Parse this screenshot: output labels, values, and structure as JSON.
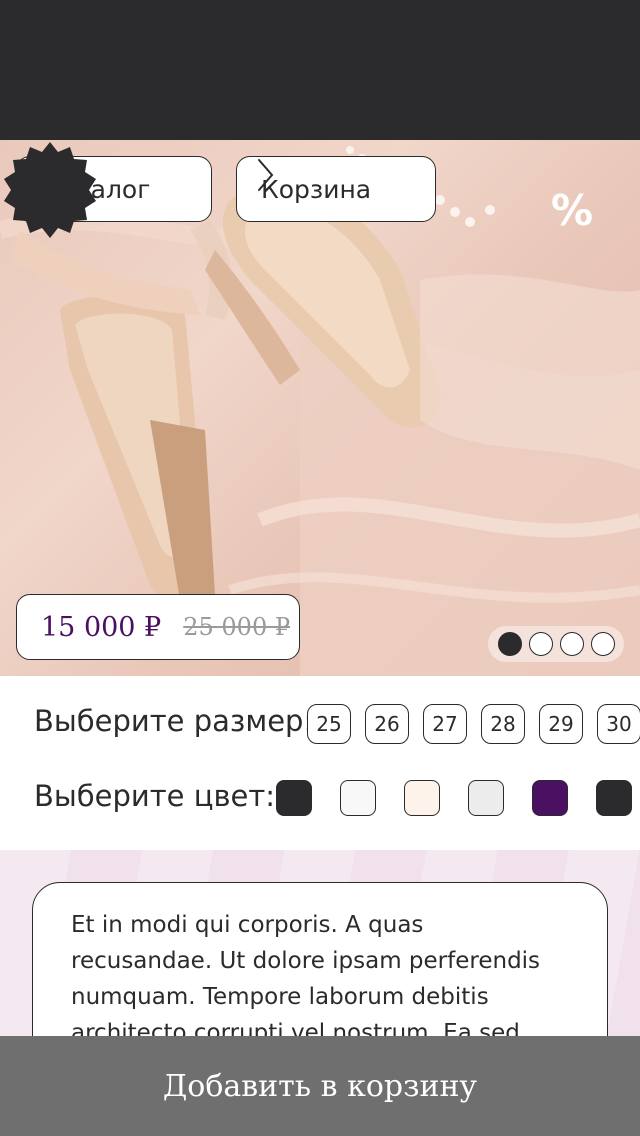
{
  "nav": {
    "back_label": "Каталог",
    "cart_label": "Корзина"
  },
  "badge": {
    "text": "%",
    "icon": "discount-badge-icon"
  },
  "price": {
    "current": "15 000 ₽",
    "old": "25 000 ₽"
  },
  "carousel": {
    "total": 4,
    "active_index": 0
  },
  "sizes": {
    "label": "Выберите размер:",
    "options": [
      "25",
      "26",
      "27",
      "28",
      "29",
      "30"
    ]
  },
  "colors": {
    "label": "Выберите цвет:",
    "options": [
      "#2b2a2c",
      "#f8f8f8",
      "#fdf3ea",
      "#ececec",
      "#4a1163",
      "#2b2a2c"
    ]
  },
  "description": {
    "text": "Et in modi qui corporis. A quas recusandae. Ut dolore ipsam perferendis numquam. Tempore laborum debitis architecto corrupti vel nostrum. Ea sed"
  },
  "cta": {
    "label": "Добавить в корзину"
  },
  "theme": {
    "accent": "#4a1163",
    "dark": "#2b2a2c",
    "cta_bg": "#6f6f6f"
  }
}
